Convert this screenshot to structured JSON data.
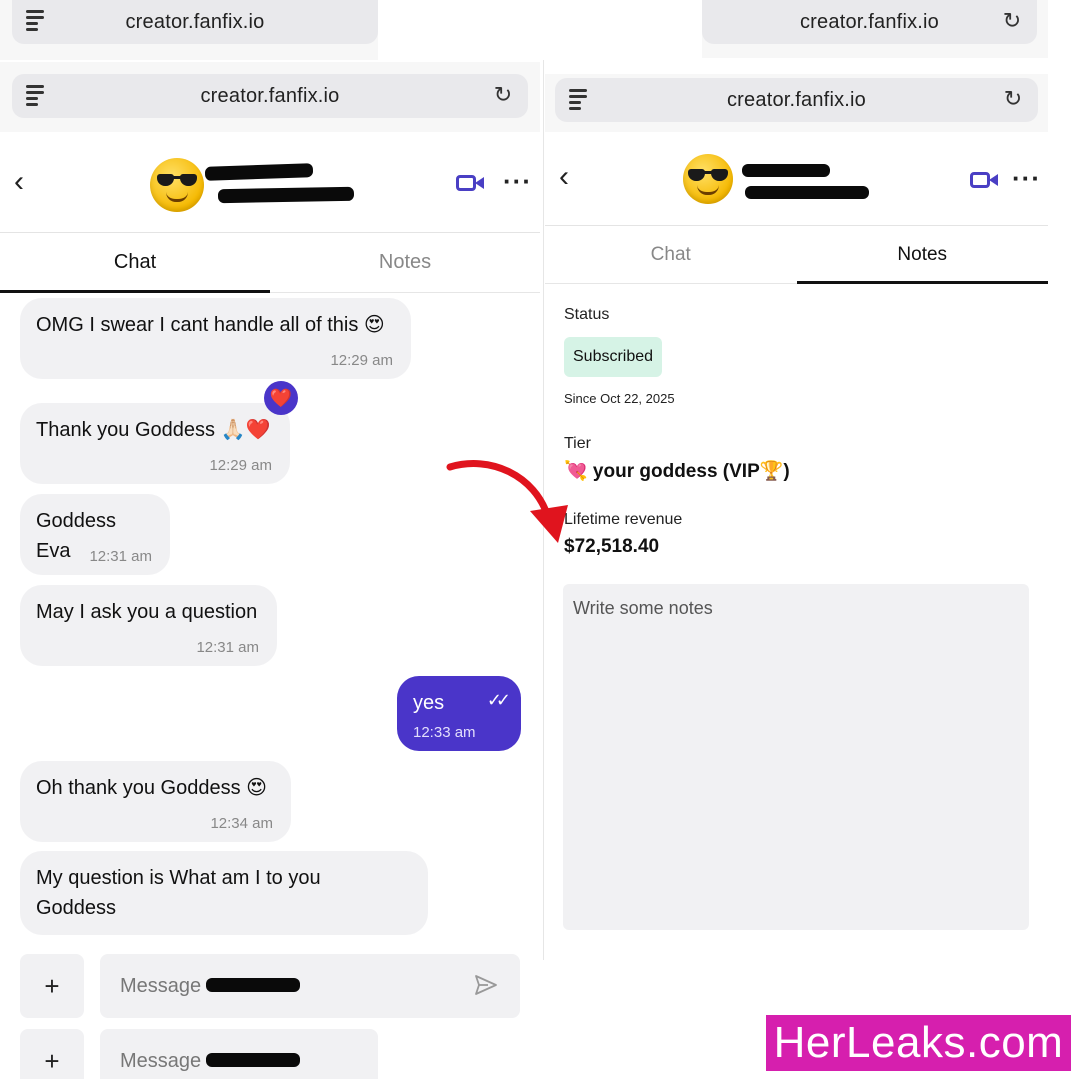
{
  "left_panel": {
    "url_top": "creator.fanfix.io",
    "url_main": "creator.fanfix.io",
    "tabs": {
      "chat": "Chat",
      "notes": "Notes"
    },
    "messages": [
      {
        "text": "OMG I swear I cant handle all of this 😍",
        "time": "12:29 am",
        "direction": "in"
      },
      {
        "text": "Thank you Goddess 🙏🏻❤️",
        "time": "12:29 am",
        "direction": "in",
        "reaction": "❤️"
      },
      {
        "text": "Goddess Eva",
        "time": "12:31 am",
        "direction": "in"
      },
      {
        "text": "May I ask you a question",
        "time": "12:31 am",
        "direction": "in"
      },
      {
        "text": "yes",
        "time": "12:33 am",
        "direction": "out"
      },
      {
        "text": "Oh thank you Goddess 😍",
        "time": "12:34 am",
        "direction": "in"
      },
      {
        "text": "My question is What am I to you Goddess",
        "time": "",
        "direction": "in"
      }
    ],
    "composer": {
      "plus": "+",
      "placeholder": "Message"
    }
  },
  "right_panel": {
    "url_top": "creator.fanfix.io",
    "url_main": "creator.fanfix.io",
    "tabs": {
      "chat": "Chat",
      "notes": "Notes"
    },
    "status_label": "Status",
    "status_value": "Subscribed",
    "since": "Since Oct 22, 2025",
    "tier_label": "Tier",
    "tier_value": "💘 your goddess (VIP🏆)",
    "revenue_label": "Lifetime revenue",
    "revenue_value": "$72,518.40",
    "notes_placeholder": "Write some notes"
  },
  "watermark": "HerLeaks.com",
  "colors": {
    "accent": "#4a35c9",
    "status_bg": "#d6f3e6",
    "watermark_bg": "#d61fae",
    "arrow": "#e0141e"
  }
}
